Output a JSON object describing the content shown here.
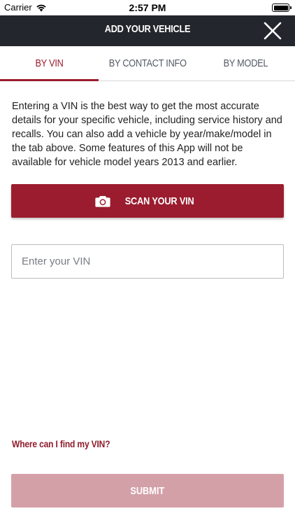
{
  "status_bar": {
    "carrier": "Carrier",
    "time": "2:57 PM",
    "icons": {
      "signal": "wifi-icon",
      "battery": "battery-icon"
    }
  },
  "header": {
    "title": "ADD YOUR VEHICLE",
    "close_icon": "close-icon"
  },
  "tabs": [
    {
      "label": "BY VIN",
      "active": true
    },
    {
      "label": "BY CONTACT INFO",
      "active": false
    },
    {
      "label": "BY MODEL",
      "active": false
    }
  ],
  "main": {
    "description": "Entering a VIN is the best way to get the most accurate details for your specific vehicle, including service history and recalls. You can also add a vehicle by year/make/model in the tab above. Some features of this App will not be available for vehicle model years 2013 and earlier.",
    "scan_button": {
      "label": "SCAN YOUR VIN",
      "icon": "camera-icon"
    },
    "vin_input": {
      "value": "",
      "placeholder": "Enter your VIN"
    },
    "help_link": "Where can I find my VIN?",
    "submit_button": {
      "label": "SUBMIT",
      "enabled": false
    }
  },
  "colors": {
    "accent": "#9b1c2e",
    "header_bg": "#24262d",
    "submit_disabled": "#d4a0a8"
  }
}
